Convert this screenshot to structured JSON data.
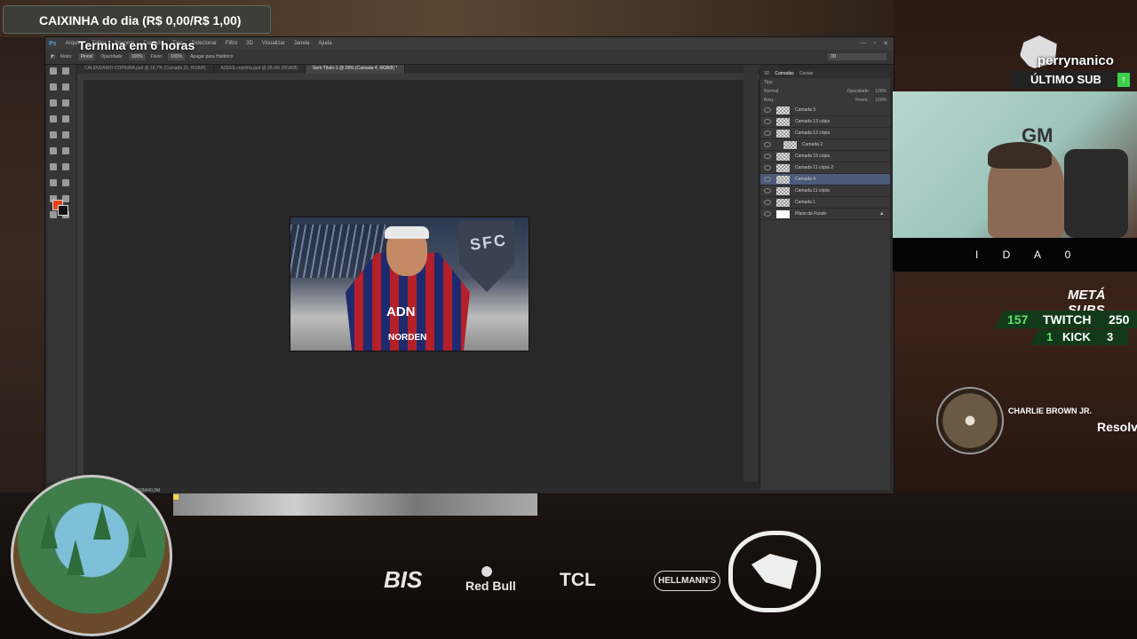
{
  "overlay": {
    "caixinha": "CAIXINHA do dia (R$ 0,00/R$ 1,00)",
    "timer": "Termina em 6 horas"
  },
  "photoshop": {
    "menu": [
      "Arquivo",
      "Editar",
      "Imagem",
      "Camada",
      "Tipo",
      "Selecionar",
      "Filtro",
      "3D",
      "Visualizar",
      "Janela",
      "Ajuda"
    ],
    "options": {
      "modo_label": "Modo:",
      "modo_value": "Pincel",
      "opacidade_label": "Opacidade:",
      "opacidade_value": "100%",
      "fluxo_label": "Fluxo:",
      "fluxo_value": "100%",
      "historico": "Apagar para Histórico",
      "workspace": "3D"
    },
    "tabs": [
      "CALENDARIO COPINHA.psd @ 16,7% (Camada 21, RGB/8)",
      "AZEEE copinha.psd @ 26,4% (RGB/8)",
      "Sem Título-1 @ 28% (Camada 4, RGB/8) *"
    ],
    "artwork": {
      "crest_text": "SFC",
      "sponsor_main": "ADN",
      "sponsor_lower": "NORDEN"
    },
    "status": "3,33M/40,0M",
    "layers_panel": {
      "tabs": [
        "3D",
        "Camadas",
        "Canais"
      ],
      "kind": "Tipo",
      "blend": "Normal",
      "opacity_label": "Opacidade:",
      "opacity_value": "100%",
      "lock_label": "Bloq.:",
      "fill_label": "Preen.:",
      "fill_value": "100%",
      "layers": [
        "Camada 3",
        "Camada 13 cópia",
        "Camada 12 cópia",
        "Camada 2",
        "Camada 15 cópia",
        "Camada 11 cópia 2",
        "Camada 4",
        "Camada 11 cópia",
        "Camada 1",
        "Plano de Fundo"
      ],
      "selected_index": 6
    }
  },
  "stream": {
    "channel": "perrynanico",
    "last_sub_label": "ÚLTIMO SUB",
    "ticker": "I D A   0",
    "meta_label": "METÁ SUBS",
    "twitch": {
      "current": "157",
      "name": "TWITCH",
      "goal": "250"
    },
    "kick": {
      "current": "1",
      "name": "KICK",
      "goal": "3"
    },
    "music": {
      "artist": "CHARLIE BROWN JR.",
      "title": "Resolv"
    },
    "webcam_text": "GM"
  },
  "sponsors": [
    "BIS",
    "Red Bull",
    "TCL",
    "HELLMANN'S"
  ],
  "colors": {
    "foreground_swatch": "#e8411c",
    "twitch_green": "#5fe06a",
    "selected_layer": "#4a5a78"
  }
}
